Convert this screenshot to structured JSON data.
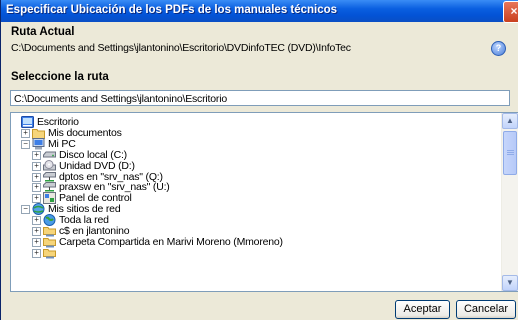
{
  "window": {
    "title": "Especificar Ubicación de los PDFs de los manuales técnicos",
    "close_glyph": "×"
  },
  "current_path": {
    "label": "Ruta Actual",
    "value": "C:\\Documents and Settings\\jlantonino\\Escritorio\\DVDinfoTEC (DVD)\\InfoTec"
  },
  "help_icon": "?",
  "select_path": {
    "label": "Seleccione la ruta",
    "value": "C:\\Documents and Settings\\jlantonino\\Escritorio"
  },
  "tree": {
    "items": [
      {
        "label": "Escritorio",
        "icon": "desktop-icon",
        "level": 0,
        "expander": ""
      },
      {
        "label": "Mis documentos",
        "icon": "folder-icon",
        "level": 1,
        "expander": "+"
      },
      {
        "label": "Mi PC",
        "icon": "my-computer-icon",
        "level": 1,
        "expander": "−"
      },
      {
        "label": "Disco local (C:)",
        "icon": "hard-drive-icon",
        "level": 2,
        "expander": "+"
      },
      {
        "label": "Unidad DVD (D:)",
        "icon": "dvd-drive-icon",
        "level": 2,
        "expander": "+"
      },
      {
        "label": "dptos en \"srv_nas\" (Q:)",
        "icon": "network-drive-icon",
        "level": 2,
        "expander": "+"
      },
      {
        "label": "praxsw en \"srv_nas\" (U:)",
        "icon": "network-drive-icon",
        "level": 2,
        "expander": "+"
      },
      {
        "label": "Panel de control",
        "icon": "control-panel-icon",
        "level": 2,
        "expander": "+"
      },
      {
        "label": "Mis sitios de red",
        "icon": "network-places-icon",
        "level": 1,
        "expander": "−"
      },
      {
        "label": "Toda la red",
        "icon": "globe-icon",
        "level": 2,
        "expander": "+"
      },
      {
        "label": "c$ en jlantonino",
        "icon": "network-share-icon",
        "level": 2,
        "expander": "+"
      },
      {
        "label": "Carpeta Compartida en Marivi Moreno (Mmoreno)",
        "icon": "network-share-icon",
        "level": 2,
        "expander": "+"
      },
      {
        "label": "",
        "icon": "network-share-icon",
        "level": 2,
        "expander": "+"
      }
    ]
  },
  "scrollbar": {
    "up_glyph": "▲",
    "down_glyph": "▼"
  },
  "buttons": {
    "accept": "Aceptar",
    "cancel": "Cancelar"
  }
}
